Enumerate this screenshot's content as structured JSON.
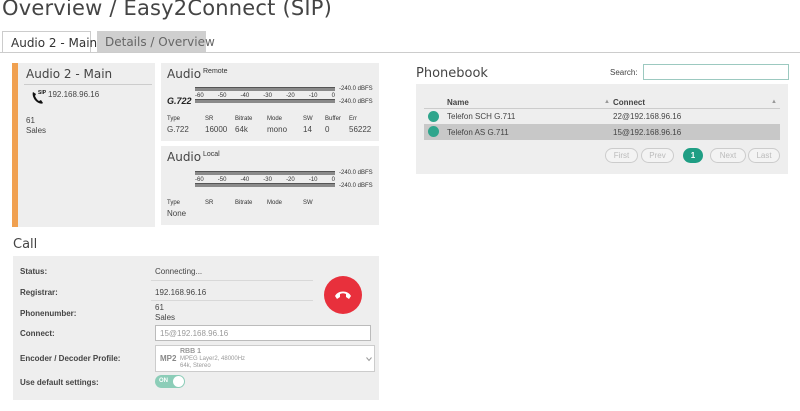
{
  "header": {
    "title": "Overview / Easy2Connect (SIP)",
    "tabs": [
      {
        "label": "Audio 2 - Main",
        "active": true
      },
      {
        "label": "Details / Overview",
        "active": false
      }
    ]
  },
  "channel": {
    "title": "Audio 2 - Main",
    "address": "192.168.96.16",
    "phone_icon_text": "SIP",
    "number": "61",
    "name": "Sales",
    "accent_color": "#f0a050"
  },
  "audio_remote": {
    "title": "Audio",
    "subtitle": "Remote",
    "codec_logo": "G.722",
    "scale": [
      "-60",
      "-50",
      "-40",
      "-30",
      "-20",
      "-10",
      "0"
    ],
    "level_top": "-240.0 dBFS",
    "level_bottom": "-240.0 dBFS",
    "cols": [
      "Type",
      "SR",
      "Bitrate",
      "Mode",
      "SW",
      "Buffer",
      "Err"
    ],
    "vals": [
      "G.722",
      "16000",
      "64k",
      "mono",
      "14",
      "0",
      "56222"
    ]
  },
  "audio_local": {
    "title": "Audio",
    "subtitle": "Local",
    "scale": [
      "-60",
      "-50",
      "-40",
      "-30",
      "-20",
      "-10",
      "0"
    ],
    "level_top": "-240.0 dBFS",
    "level_bottom": "-240.0 dBFS",
    "cols": [
      "Type",
      "SR",
      "Bitrate",
      "Mode",
      "SW"
    ],
    "vals": [
      "None",
      "",
      "",
      "",
      ""
    ]
  },
  "call": {
    "title": "Call",
    "status_label": "Status:",
    "status_value": "Connecting...",
    "registrar_label": "Registrar:",
    "registrar_value": "192.168.96.16",
    "phonenumber_label": "Phonenumber:",
    "phonenumber_value": "61",
    "phonenumber_name": "Sales",
    "connect_label": "Connect:",
    "connect_value": "15@192.168.96.16",
    "profile_label": "Encoder / Decoder Profile:",
    "profile_badge": "MP2",
    "profile_name": "RBB 1",
    "profile_line1": "MPEG Layer2, 48000Hz",
    "profile_line2": "64k, Stereo",
    "default_label": "Use default settings:",
    "toggle_label": "ON",
    "hangup_color": "#e8303c"
  },
  "phonebook": {
    "title": "Phonebook",
    "search_label": "Search:",
    "search_value": "",
    "col_name": "Name",
    "col_connect": "Connect",
    "rows": [
      {
        "name": "Telefon SCH G.711",
        "connect": "22@192.168.96.16",
        "selected": false
      },
      {
        "name": "Telefon AS G.711",
        "connect": "15@192.168.96.16",
        "selected": true
      }
    ],
    "pagination": {
      "first": "First",
      "prev": "Prev",
      "current": "1",
      "next": "Next",
      "last": "Last"
    }
  }
}
